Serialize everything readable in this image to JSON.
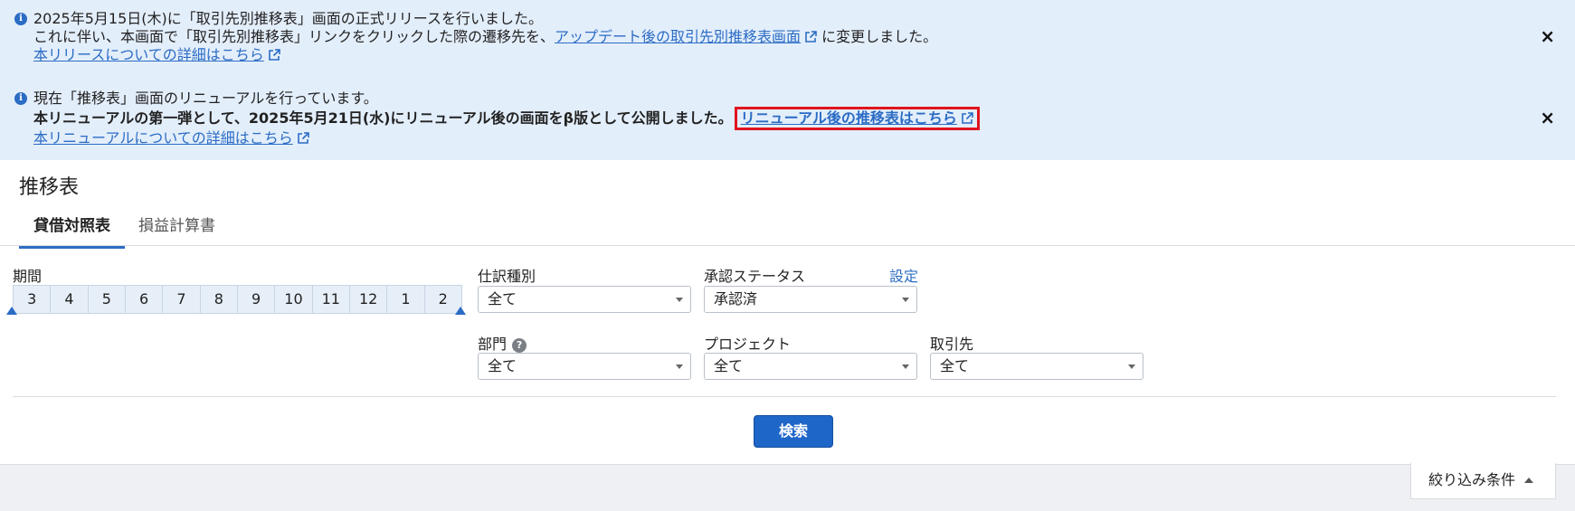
{
  "notices": [
    {
      "line1": "2025年5月15日(木)に「取引先別推移表」画面の正式リリースを行いました。",
      "line2_prefix": "これに伴い、本画面で「取引先別推移表」リンクをクリックした際の遷移先を、",
      "line2_link": "アップデート後の取引先別推移表画面",
      "line2_suffix": "に変更しました。",
      "detail_link": "本リリースについての詳細はこちら",
      "close": "×"
    },
    {
      "line1": "現在「推移表」画面のリニューアルを行っています。",
      "line2_prefix": "本リニューアルの第一弾として、2025年5月21日(水)にリニューアル後の画面をβ版として公開しました。",
      "line2_link": "リニューアル後の推移表はこちら",
      "detail_link": "本リニューアルについての詳細はこちら",
      "close": "×"
    }
  ],
  "page": {
    "title": "推移表"
  },
  "tabs": [
    {
      "label": "貸借対照表",
      "active": true
    },
    {
      "label": "損益計算書",
      "active": false
    }
  ],
  "period": {
    "label": "期間",
    "months": [
      "3",
      "4",
      "5",
      "6",
      "7",
      "8",
      "9",
      "10",
      "11",
      "12",
      "1",
      "2"
    ]
  },
  "filters": {
    "journal_type": {
      "label": "仕訳種別",
      "value": "全て"
    },
    "approval_status": {
      "label": "承認ステータス",
      "value": "承認済",
      "settings_link": "設定"
    },
    "department": {
      "label": "部門",
      "value": "全て",
      "help": "?"
    },
    "project": {
      "label": "プロジェクト",
      "value": "全て"
    },
    "partner": {
      "label": "取引先",
      "value": "全て"
    }
  },
  "search_button": "検索",
  "filter_toggle": "絞り込み条件",
  "colors": {
    "accent": "#2b6cc4",
    "notice_bg": "#e3eefb",
    "highlight": "#e0141e",
    "primary_button": "#1f66c9"
  }
}
